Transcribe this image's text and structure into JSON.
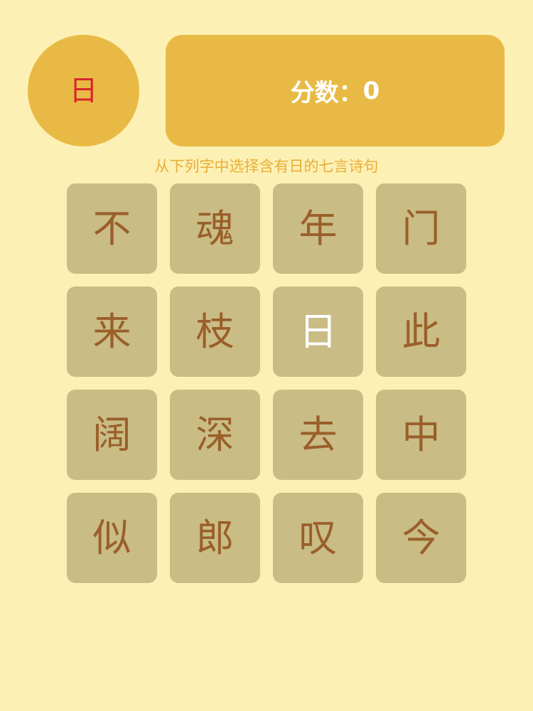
{
  "target_char": "日",
  "score": {
    "label": "分数：",
    "value": "0"
  },
  "instruction": "从下列字中选择含有日的七言诗句",
  "tiles": [
    {
      "char": "不",
      "selected": false
    },
    {
      "char": "魂",
      "selected": false
    },
    {
      "char": "年",
      "selected": false
    },
    {
      "char": "门",
      "selected": false
    },
    {
      "char": "来",
      "selected": false
    },
    {
      "char": "枝",
      "selected": false
    },
    {
      "char": "日",
      "selected": true
    },
    {
      "char": "此",
      "selected": false
    },
    {
      "char": "阔",
      "selected": false
    },
    {
      "char": "深",
      "selected": false
    },
    {
      "char": "去",
      "selected": false
    },
    {
      "char": "中",
      "selected": false
    },
    {
      "char": "似",
      "selected": false
    },
    {
      "char": "郎",
      "selected": false
    },
    {
      "char": "叹",
      "selected": false
    },
    {
      "char": "今",
      "selected": false
    }
  ],
  "colors": {
    "background": "#fdf0b4",
    "accent": "#e8ba45",
    "tile": "#c9bc85",
    "tile_text": "#9a5f2a",
    "tile_selected_text": "#ffffff",
    "target_char_text": "#d8262a",
    "instruction_text": "#e8ae38"
  }
}
